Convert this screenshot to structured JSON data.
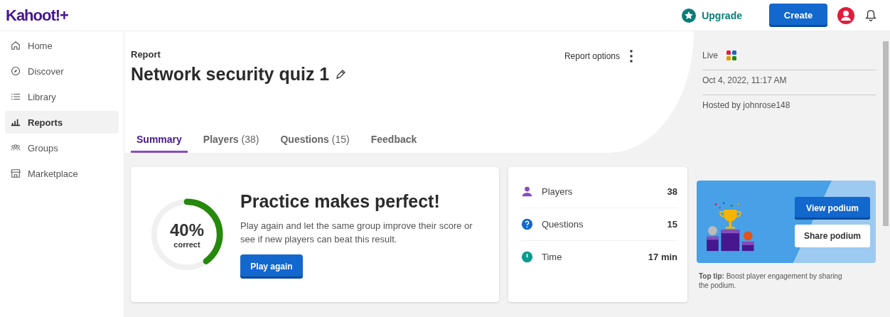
{
  "header": {
    "logo": "Kahoot!+",
    "upgrade": "Upgrade",
    "create": "Create"
  },
  "sidebar": {
    "items": [
      {
        "label": "Home",
        "kind": "home",
        "selected": false
      },
      {
        "label": "Discover",
        "kind": "compass",
        "selected": false
      },
      {
        "label": "Library",
        "kind": "list",
        "selected": false
      },
      {
        "label": "Reports",
        "kind": "chart",
        "selected": true
      },
      {
        "label": "Groups",
        "kind": "group",
        "selected": false
      },
      {
        "label": "Marketplace",
        "kind": "store",
        "selected": false
      }
    ]
  },
  "report": {
    "eyebrow": "Report",
    "title": "Network security quiz 1",
    "options": "Report options"
  },
  "tabs": [
    {
      "label": "Summary",
      "selected": true
    },
    {
      "label": "Players",
      "count": "(38)",
      "selected": false
    },
    {
      "label": "Questions",
      "count": "(15)",
      "selected": false
    },
    {
      "label": "Feedback",
      "selected": false
    }
  ],
  "info": {
    "mode": "Live",
    "date": "Oct 4, 2022, 11:17 AM",
    "host": "Hosted by johnrose148"
  },
  "score": {
    "level": 0.4,
    "percent": "40%",
    "caption": "correct",
    "heading": "Practice makes perfect!",
    "text": "Play again and let the same group improve their score or see if new players can beat this result.",
    "button": "Play again"
  },
  "stats": [
    {
      "kind": "players",
      "label": "Players",
      "value": "38"
    },
    {
      "kind": "questions",
      "label": "Questions",
      "value": "15"
    },
    {
      "kind": "time",
      "label": "Time",
      "value": "17 min"
    }
  ],
  "podium": {
    "view": "View podium",
    "share": "Share podium",
    "tip": "**Top tip:** Boost player engagement by sharing the podium."
  }
}
